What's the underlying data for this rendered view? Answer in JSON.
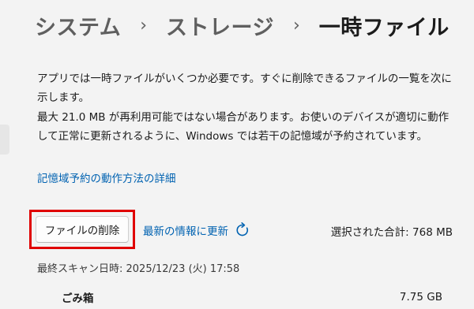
{
  "breadcrumb": {
    "items": [
      "システム",
      "ストレージ",
      "一時ファイル"
    ],
    "separator": "›"
  },
  "description": "アプリでは一時ファイルがいくつか必要です。すぐに削除できるファイルの一覧を次に示します。",
  "reserved_notice": "最大 21.0 MB が再利用可能ではない場合があります。お使いのデバイスが適切に動作して正常に更新されるように、Windows では若干の記憶域が予約されています。",
  "learn_more_link": "記憶域予約の動作方法の詳細",
  "actions": {
    "delete_button": "ファイルの削除",
    "refresh_link": "最新の情報に更新",
    "refresh_icon": "refresh-icon"
  },
  "selected_total": "選択された合計: 768 MB",
  "last_scan": "最終スキャン日時: 2025/12/23 (火) 17:58",
  "items": [
    {
      "name": "ごみ箱",
      "size": "7.75 GB"
    }
  ],
  "colors": {
    "background": "#f3f3f3",
    "link": "#0062b1",
    "highlight_border": "#e00000",
    "text": "#1b1b1b"
  }
}
